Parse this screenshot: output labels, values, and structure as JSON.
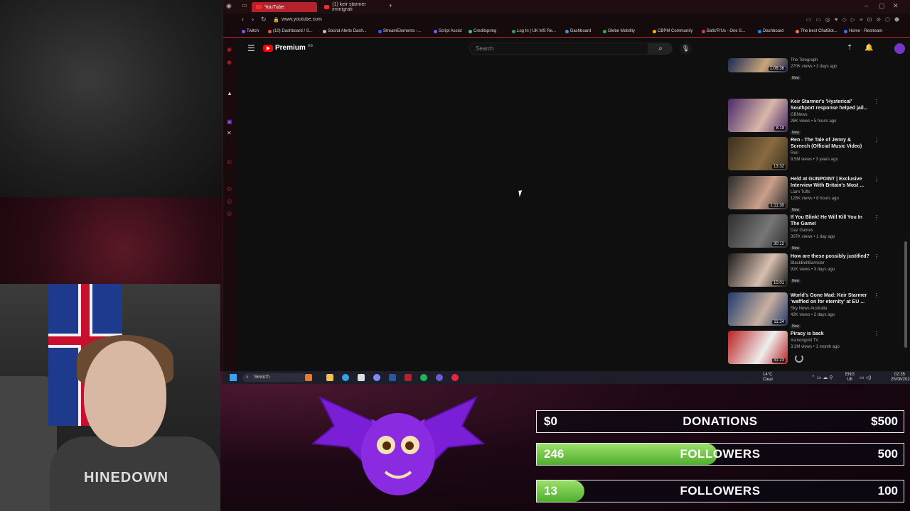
{
  "browser": {
    "tabs": [
      {
        "label": "YouTube",
        "active": true
      },
      {
        "label": "(1) keir starmer immigrati",
        "active": false
      }
    ],
    "new_tab": "+",
    "url": "www.youtube.com",
    "bookmarks": [
      {
        "label": "Twitch",
        "color": "#9146ff"
      },
      {
        "label": "(10) Dashboard / S...",
        "color": "#ff4d4d"
      },
      {
        "label": "Sound Alerts Dash...",
        "color": "#c0c0c0"
      },
      {
        "label": "StreamElements -...",
        "color": "#3f51ff"
      },
      {
        "label": "Script Assist",
        "color": "#7a5cff"
      },
      {
        "label": "Creditspring",
        "color": "#3ac4a0"
      },
      {
        "label": "Log In | UK MS Re...",
        "color": "#2ea44f"
      },
      {
        "label": "Dashboard",
        "color": "#4a90e2"
      },
      {
        "label": "Glebe Mobility",
        "color": "#34a853"
      },
      {
        "label": "CBPM Community",
        "color": "#f4b400"
      },
      {
        "label": "Balls'R'Us - One S...",
        "color": "#e53935"
      },
      {
        "label": "Dashboard",
        "color": "#1e88e5"
      },
      {
        "label": "The best ChatBot...",
        "color": "#ff7043"
      },
      {
        "label": "Home - Restream",
        "color": "#3f6bff"
      }
    ]
  },
  "youtube": {
    "logo_text": "Premium",
    "logo_region": "GB",
    "search_placeholder": "Search",
    "recommendations": [
      {
        "title": "",
        "channel": "The Telegraph",
        "meta": "270K views • 2 days ago",
        "badge": "New",
        "duration": "1:06:36",
        "thumb_colors": [
          "#1a2a55",
          "#c9a57a"
        ]
      },
      {
        "title": "Keir Starmer's 'Hysterical' Southport response helped jail...",
        "channel": "GBNews",
        "meta": "26K views • 5 hours ago",
        "badge": "New",
        "duration": "8:19",
        "thumb_colors": [
          "#4b2a6a",
          "#d9b7a8"
        ]
      },
      {
        "title": "Ren - The Tale of Jenny & Screech (Official Music Video)",
        "channel": "Ren",
        "meta": "9.5M views • 3 years ago",
        "badge": "",
        "duration": "13:32",
        "thumb_colors": [
          "#3a3020",
          "#8a6a40"
        ]
      },
      {
        "title": "Held at GUNPOINT | Exclusive Interview With Britain's Most ...",
        "channel": "Liam Tuffs",
        "meta": "128K views • 8 hours ago",
        "badge": "New",
        "duration": "1:11:30",
        "thumb_colors": [
          "#2a2a2a",
          "#caa08a"
        ]
      },
      {
        "title": "If You Blink! He Will Kill You In The Game!",
        "channel": "Daz Games",
        "meta": "307K views • 1 day ago",
        "badge": "New",
        "duration": "30:12",
        "thumb_colors": [
          "#2e2e2e",
          "#777"
        ]
      },
      {
        "title": "How are these possibly justified?",
        "channel": "BlackBeltBarrister",
        "meta": "91K views • 3 days ago",
        "badge": "New",
        "duration": "10:01",
        "thumb_colors": [
          "#1a1a1a",
          "#d8c0b0"
        ]
      },
      {
        "title": "World's Gone Mad: Keir Starmer 'waffled on for eternity' at EU ...",
        "channel": "Sky News Australia",
        "meta": "42K views • 2 days ago",
        "badge": "New",
        "duration": "11:24",
        "thumb_colors": [
          "#203a6a",
          "#c8b0a0"
        ]
      },
      {
        "title": "Piracy is back",
        "channel": "Asmongold TV",
        "meta": "3.3M views • 1 month ago",
        "badge": "",
        "duration": "31:23",
        "thumb_colors": [
          "#b22",
          "#eee"
        ]
      }
    ]
  },
  "taskbar": {
    "search": "Search",
    "weather_temp": "14°C",
    "weather_desc": "Clear",
    "lang_top": "ENG",
    "lang_bottom": "UK",
    "time": "02:35",
    "date": "25/08/2025"
  },
  "overlay": {
    "shirt_text": "HINEDOWN",
    "goals": [
      {
        "low": "$0",
        "label": "DONATIONS",
        "high": "$500",
        "progress": 0
      },
      {
        "low": "246",
        "label": "FOLLOWERS",
        "high": "500",
        "progress": 0.492
      },
      {
        "low": "13",
        "label": "FOLLOWERS",
        "high": "100",
        "progress": 0.13
      }
    ]
  }
}
